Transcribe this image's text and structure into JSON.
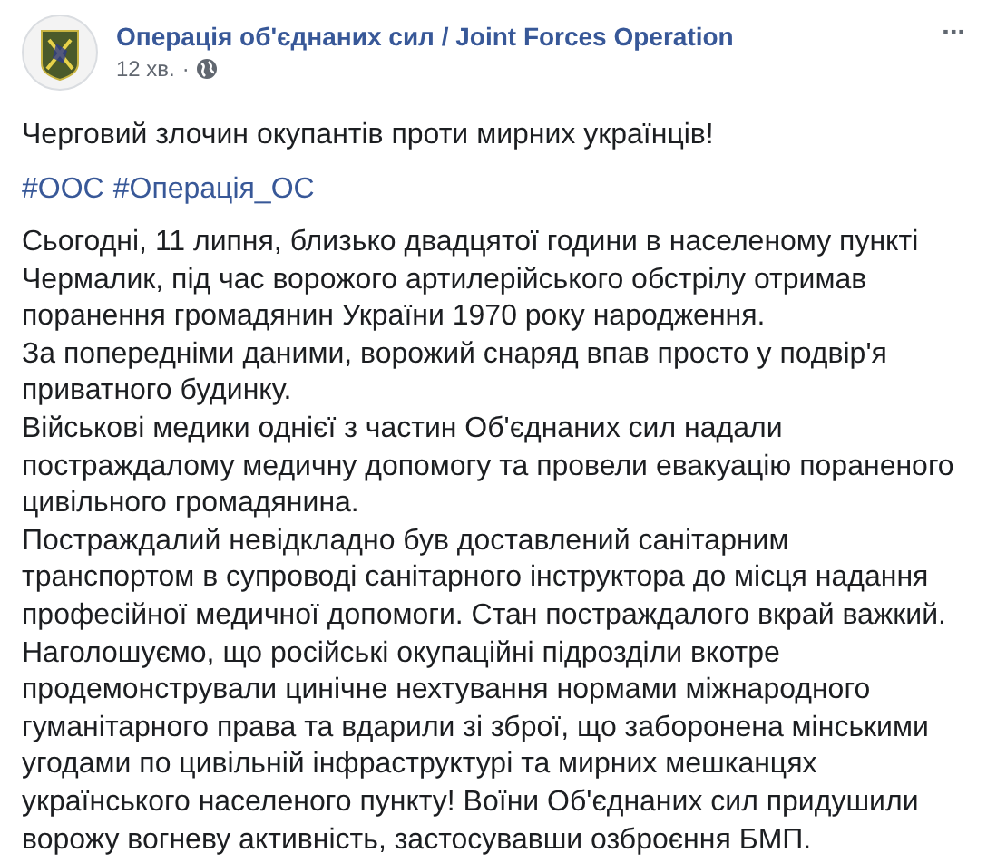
{
  "post": {
    "author": "Операція об'єднаних сил / Joint Forces Operation",
    "time": "12 хв.",
    "separator": "·",
    "menu": "···",
    "headline": "Черговий злочин окупантів проти мирних українців!",
    "hashtags": [
      "#ООС",
      "#Операція_ОС"
    ],
    "paragraphs": [
      "Сьогодні, 11 липня, близько двадцятої години в населеному пункті Чермалик, під час ворожого артилерійського обстрілу отримав поранення громадянин України 1970 року народження.",
      "За попередніми даними, ворожий снаряд впав просто у подвір'я приватного будинку.",
      "Військові медики однієї з частин Об'єднаних сил надали постраждалому медичну допомогу та провели евакуацію пораненого цивільного громадянина.",
      "Постраждалий невідкладно був доставлений санітарним транспортом в супроводі санітарного інструктора до місця надання професійної медичної допомоги. Стан постраждалого вкрай важкий.",
      "Наголошуємо, що російські окупаційні підрозділи вкотре продемонстрували цинічне нехтування нормами міжнародного гуманітарного права та вдарили зі зброї, що заборонена мінськими угодами по цивільній інфраструктурі та мирних мешканцях українського населеного пункту! Воїни Об'єднаних сил придушили ворожу вогневу активність, застосувавши озброєння БМП."
    ]
  }
}
